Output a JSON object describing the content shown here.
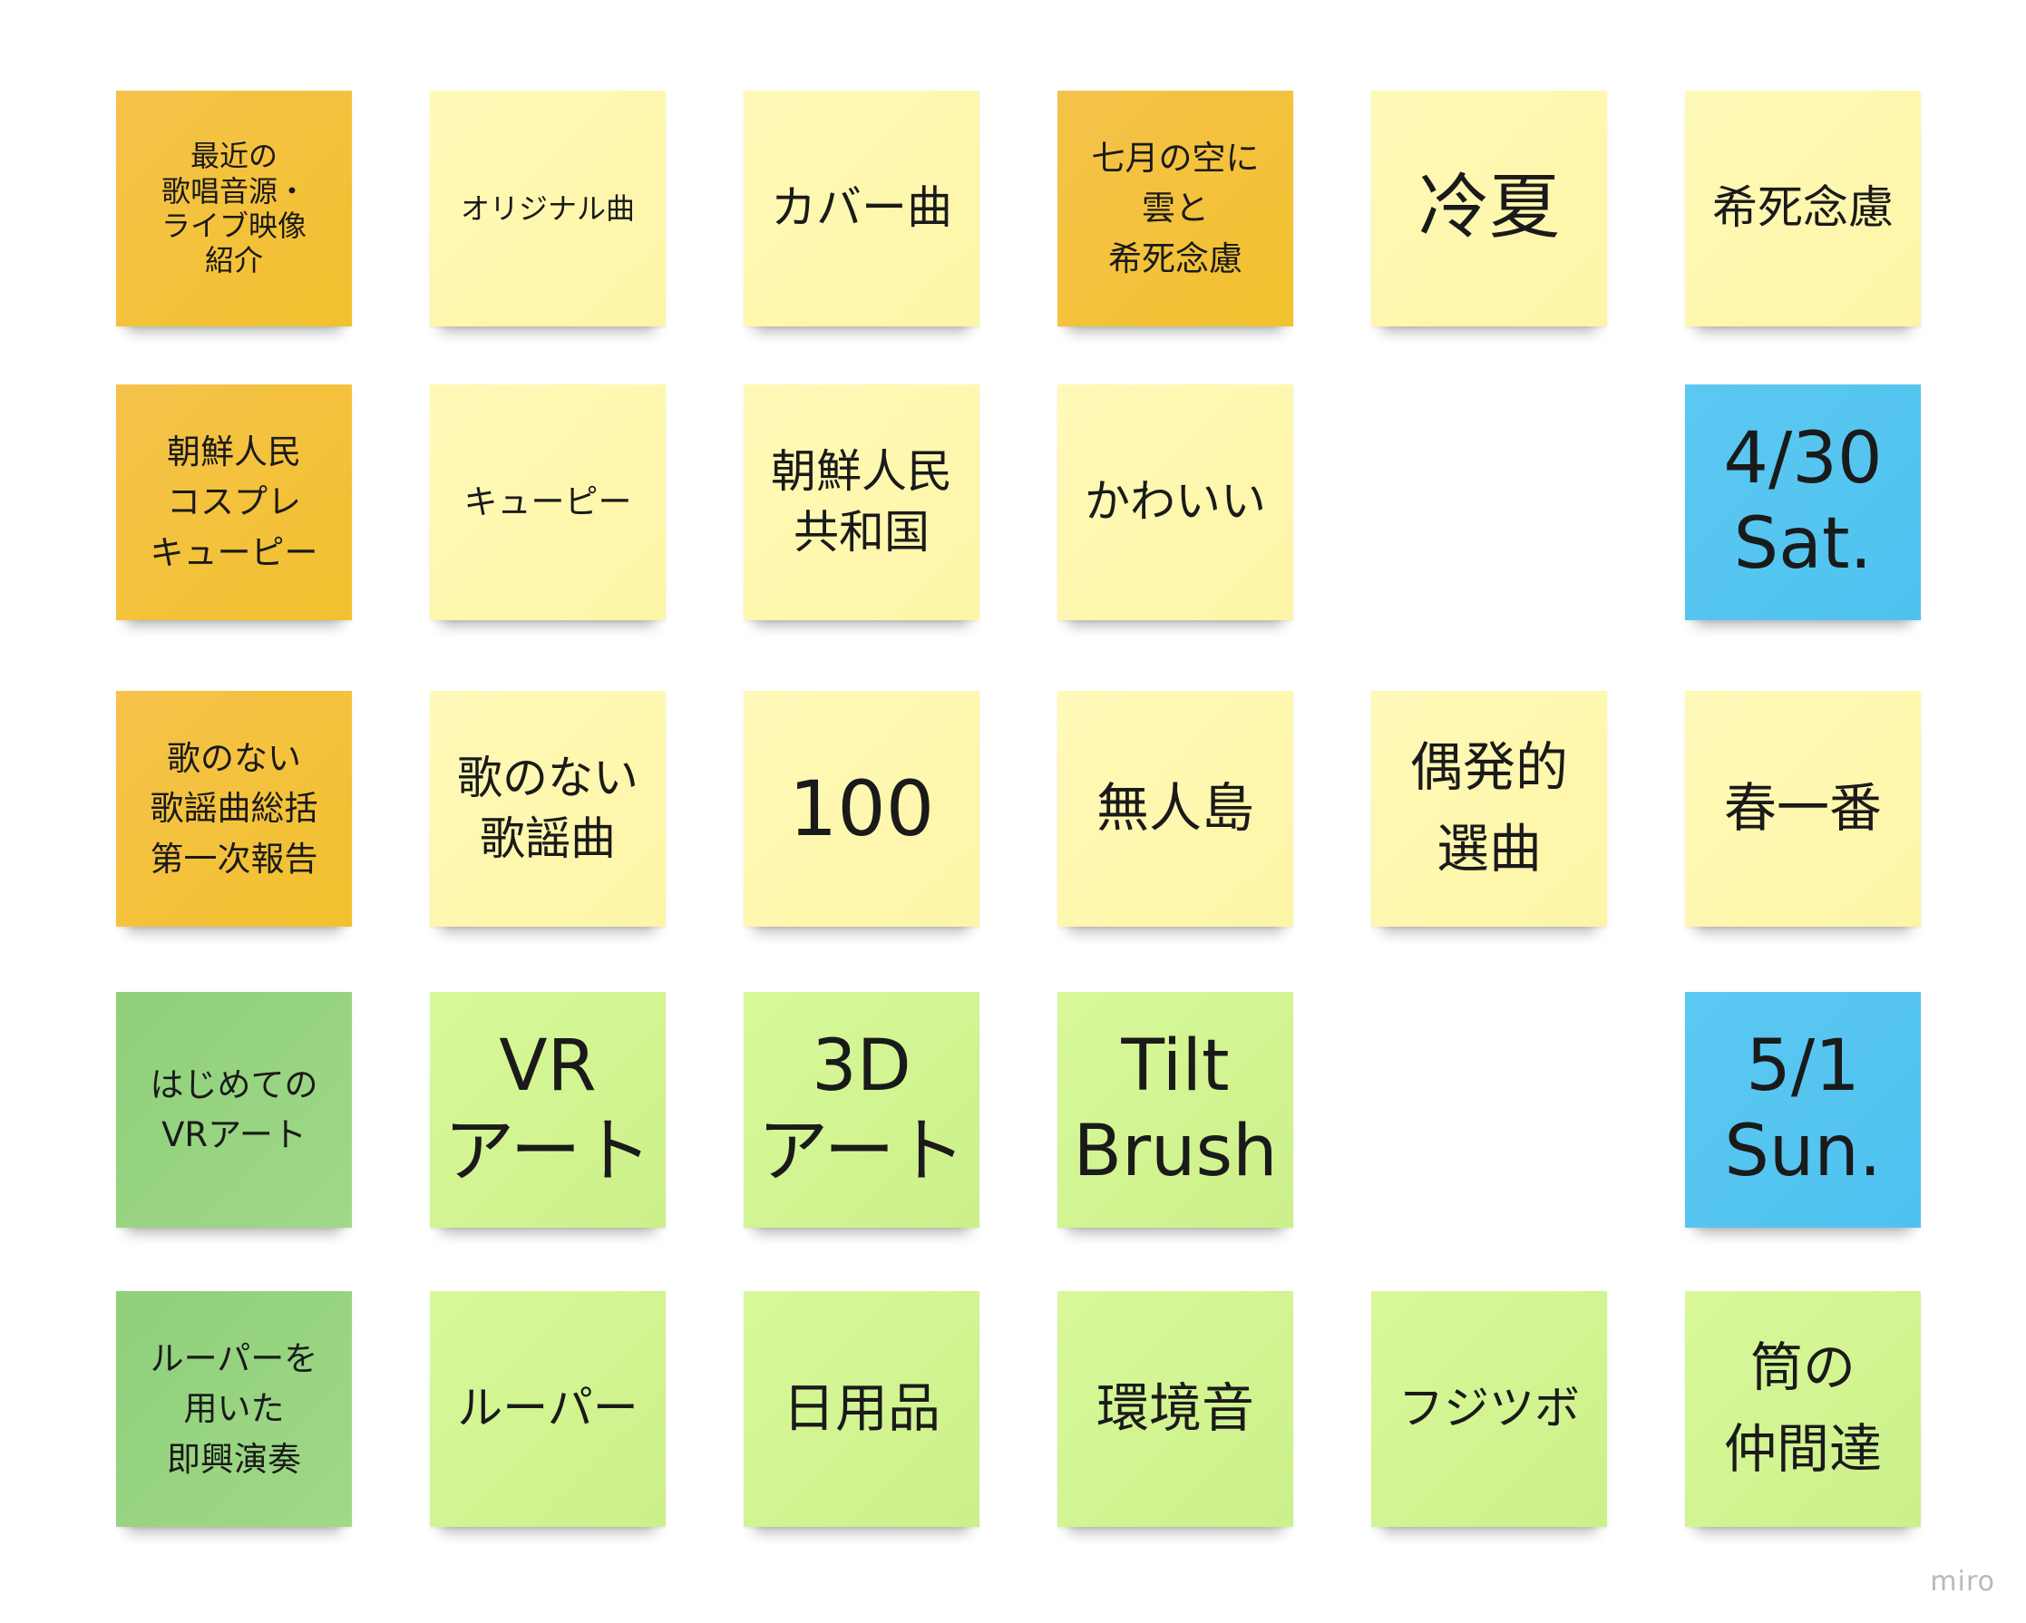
{
  "notes": {
    "r1c1": "最近の\n歌唱音源・\nライブ映像\n紹介",
    "r1c2": "オリジナル曲",
    "r1c3": "カバー曲",
    "r1c4": "七月の空に\n雲と\n希死念慮",
    "r1c5": "冷夏",
    "r1c6": "希死念慮",
    "r2c1": "朝鮮人民\nコスプレ\nキューピー",
    "r2c2": "キューピー",
    "r2c3": "朝鮮人民\n共和国",
    "r2c4": "かわいい",
    "r2c6": "4/30\nSat.",
    "r3c1": "歌のない\n歌謡曲総括\n第一次報告",
    "r3c2": "歌のない\n歌謡曲",
    "r3c3": "100",
    "r3c4": "無人島",
    "r3c5": "偶発的\n選曲",
    "r3c6": "春一番",
    "r4c1": "はじめての\nVRアート",
    "r4c2": "VR\nアート",
    "r4c3": "3D\nアート",
    "r4c4": "Tilt\nBrush",
    "r4c6": "5/1\nSun.",
    "r5c1": "ルーパーを\n用いた\n即興演奏",
    "r5c2": "ルーパー",
    "r5c3": "日用品",
    "r5c4": "環境音",
    "r5c5": "フジツボ",
    "r5c6": "筒の\n仲間達"
  },
  "colors": {
    "orange": "#f2c12e",
    "yellow": "#fdf5a6",
    "lime": "#ccf08a",
    "green": "#97d480",
    "blue": "#4fc2ef"
  },
  "branding": {
    "logo": "miro"
  }
}
